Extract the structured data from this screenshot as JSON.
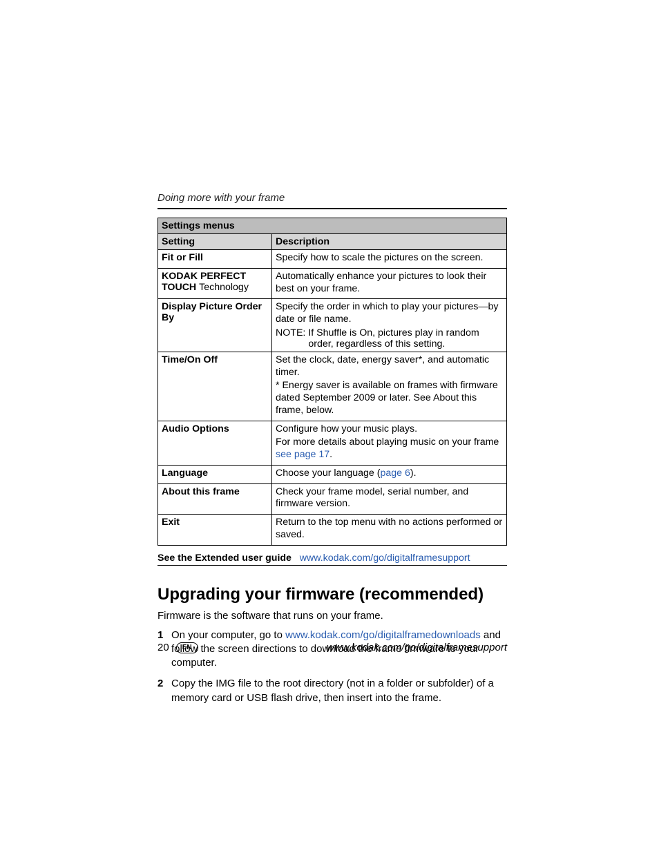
{
  "runningHead": "Doing more with your frame",
  "table": {
    "title": "Settings menus",
    "colSetting": "Setting",
    "colDescription": "Description",
    "rows": {
      "fitFill": {
        "name": "Fit or Fill",
        "desc": "Specify how to scale the pictures on the screen."
      },
      "kodakTouch": {
        "line1": "KODAK PERFECT TOUCH",
        "line2": "Technology",
        "desc": "Automatically enhance your pictures to look their best on your frame."
      },
      "displayOrder": {
        "name": "Display Picture Order By",
        "desc": "Specify the order in which to play your pictures—by date or file name.",
        "noteLabel": "NOTE:",
        "noteBody": "If Shuffle is On, pictures play in random order, regardless of this setting."
      },
      "timeOnOff": {
        "name": "Time/On Off",
        "p1": "Set the clock, date, energy saver*, and automatic timer.",
        "p2": "* Energy saver is available on frames with firmware dated September 2009 or later. See About this frame, below."
      },
      "audio": {
        "name": "Audio Options",
        "p1": "Configure how your music plays.",
        "p2a": "For more details about playing music on your frame ",
        "link": "see page 17",
        "p2b": "."
      },
      "language": {
        "name": "Language",
        "descA": "Choose your language (",
        "link": "page 6",
        "descB": ")."
      },
      "about": {
        "name": "About this frame",
        "desc": "Check your frame model, serial number, and firmware version."
      },
      "exit": {
        "name": "Exit",
        "desc": "Return to the top menu with no actions performed or saved."
      }
    }
  },
  "guide": {
    "lead": "See the Extended user guide",
    "link": "www.kodak.com/go/digitalframesupport"
  },
  "section": {
    "title": "Upgrading your firmware (recommended)",
    "intro": "Firmware is the software that runs on your frame.",
    "steps": {
      "s1": {
        "num": "1",
        "a": "On your computer, go to ",
        "link": "www.kodak.com/go/digitalframedownloads",
        "b": " and follow the screen directions to download the frame firmware to your computer."
      },
      "s2": {
        "num": "2",
        "text": "Copy the IMG file to the root directory (not in a folder or subfolder) of a memory card or USB flash drive, then insert into the frame."
      }
    }
  },
  "footer": {
    "pageNum": "20",
    "langBadge": "EN",
    "url": "www.kodak.com/go/digitalframesupport"
  }
}
